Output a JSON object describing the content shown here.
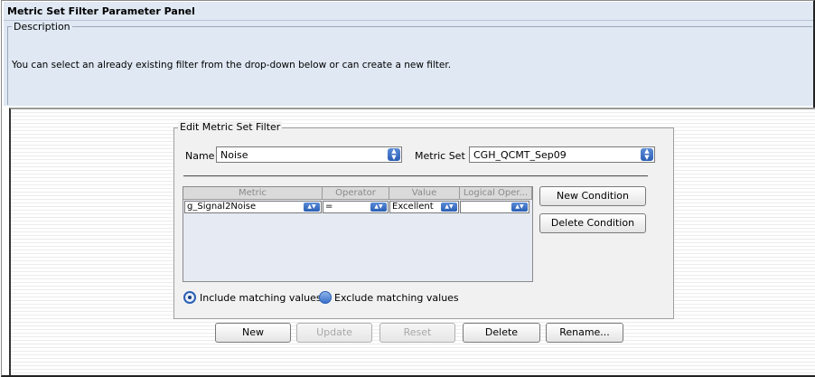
{
  "panel": {
    "title": "Metric Set Filter Parameter Panel",
    "description_legend": "Description",
    "description_text": "You can select an already existing filter from the drop-down below or can create a new filter."
  },
  "filter": {
    "legend": "Edit Metric Set Filter",
    "name_label": "Name",
    "name_value": "Noise",
    "metric_set_label": "Metric Set",
    "metric_set_value": "CGH_QCMT_Sep09",
    "table": {
      "headers": [
        "Metric",
        "Operator",
        "Value",
        "Logical Oper..."
      ],
      "rows": [
        {
          "metric": "g_Signal2Noise",
          "operator": "=",
          "value": "Excellent",
          "logical": ""
        }
      ]
    },
    "new_condition": "New Condition",
    "delete_condition": "Delete Condition",
    "include_label": "Include matching values",
    "exclude_label": "Exclude matching values",
    "include_selected": true
  },
  "actions": {
    "new": "New",
    "update": "Update",
    "reset": "Reset",
    "delete": "Delete",
    "rename": "Rename..."
  },
  "icons": {
    "dropdown": "chevron-updown-icon"
  },
  "colors": {
    "panel_bg": "#dfe8f3",
    "accent": "#2a5fb5"
  }
}
